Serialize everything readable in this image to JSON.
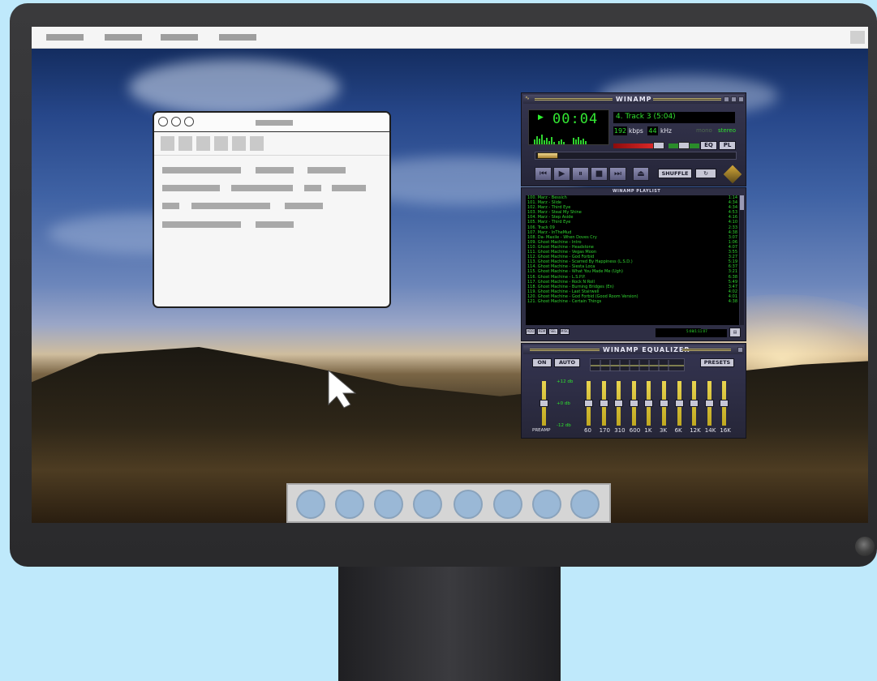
{
  "desktop": {
    "menu_placeholder_count": 4,
    "dock_icon_count": 8
  },
  "placeholder_window": {
    "toolbar_button_count": 6
  },
  "winamp": {
    "title": "WINAMP",
    "time": "00:04",
    "track": "4. Track 3 (5:04)",
    "bitrate": "192",
    "bitrate_unit": "kbps",
    "samplerate": "44",
    "samplerate_unit": "kHz",
    "mono_label": "mono",
    "stereo_label": "stereo",
    "eq_button": "EQ",
    "pl_button": "PL",
    "shuffle_button": "SHUFFLE",
    "play_state": "playing",
    "seek_position_fraction": 0.01
  },
  "playlist": {
    "title": "WINAMP PLAYLIST",
    "items": [
      {
        "name": "100. Marz - Bessich",
        "duration": "1:14"
      },
      {
        "name": "101. Marz - Slide",
        "duration": "4:34"
      },
      {
        "name": "102. Marz - Third Eye",
        "duration": "4:34"
      },
      {
        "name": "103. Marz - Steal My Shine",
        "duration": "4:53"
      },
      {
        "name": "104. Marz - Step Aside",
        "duration": "4:16"
      },
      {
        "name": "105. Marz - Third Eye",
        "duration": "4:10"
      },
      {
        "name": "106. Track 09",
        "duration": "2:33"
      },
      {
        "name": "107. Marz - InTheMud",
        "duration": "4:38"
      },
      {
        "name": "108. Da- Maxile - When Doves Cry",
        "duration": "3:07"
      },
      {
        "name": "109. Ghost Machine - Intro",
        "duration": "1:06"
      },
      {
        "name": "110. Ghost Machine - Headstone",
        "duration": "4:07"
      },
      {
        "name": "111. Ghost Machine - Vegas Moon",
        "duration": "3:55"
      },
      {
        "name": "112. Ghost Machine - God Forbid",
        "duration": "3:27"
      },
      {
        "name": "113. Ghost Machine - Scarred By Happiness (L.S.D.)",
        "duration": "5:19"
      },
      {
        "name": "114. Ghost Machine - Siesta Loca",
        "duration": "6:37"
      },
      {
        "name": "115. Ghost Machine - What You Made Me (Ugh)",
        "duration": "3:21"
      },
      {
        "name": "116. Ghost Machine - L.S.P.P.",
        "duration": "6:38"
      },
      {
        "name": "117. Ghost Machine - Rock N Roll",
        "duration": "5:49"
      },
      {
        "name": "118. Ghost Machine - Burning Bridges (En)",
        "duration": "3:47"
      },
      {
        "name": "119. Ghost Machine - Last Stairwell",
        "duration": "4:02"
      },
      {
        "name": "120. Ghost Machine - God Forbid (Good Room Version)",
        "duration": "4:01"
      },
      {
        "name": "121. Ghost Machine - Certain Things",
        "duration": "4:38"
      }
    ],
    "buttons": [
      "ADD",
      "REM",
      "SEL",
      "MISC"
    ],
    "info_time": "5:08/1:11:07"
  },
  "equalizer": {
    "title": "WINAMP EQUALIZER",
    "on_label": "ON",
    "auto_label": "AUTO",
    "presets_label": "PRESETS",
    "db_top": "+12 db",
    "db_mid": "+0 db",
    "db_bot": "-12 db",
    "preamp_label": "PREAMP",
    "bands": [
      "60",
      "170",
      "310",
      "600",
      "1K",
      "3K",
      "6K",
      "12K",
      "14K",
      "16K"
    ]
  },
  "colors": {
    "lcd_green": "#33e833",
    "eq_slider": "#e8d450",
    "sky_top": "#0d2452",
    "body_bg": "#bfe9fb"
  }
}
